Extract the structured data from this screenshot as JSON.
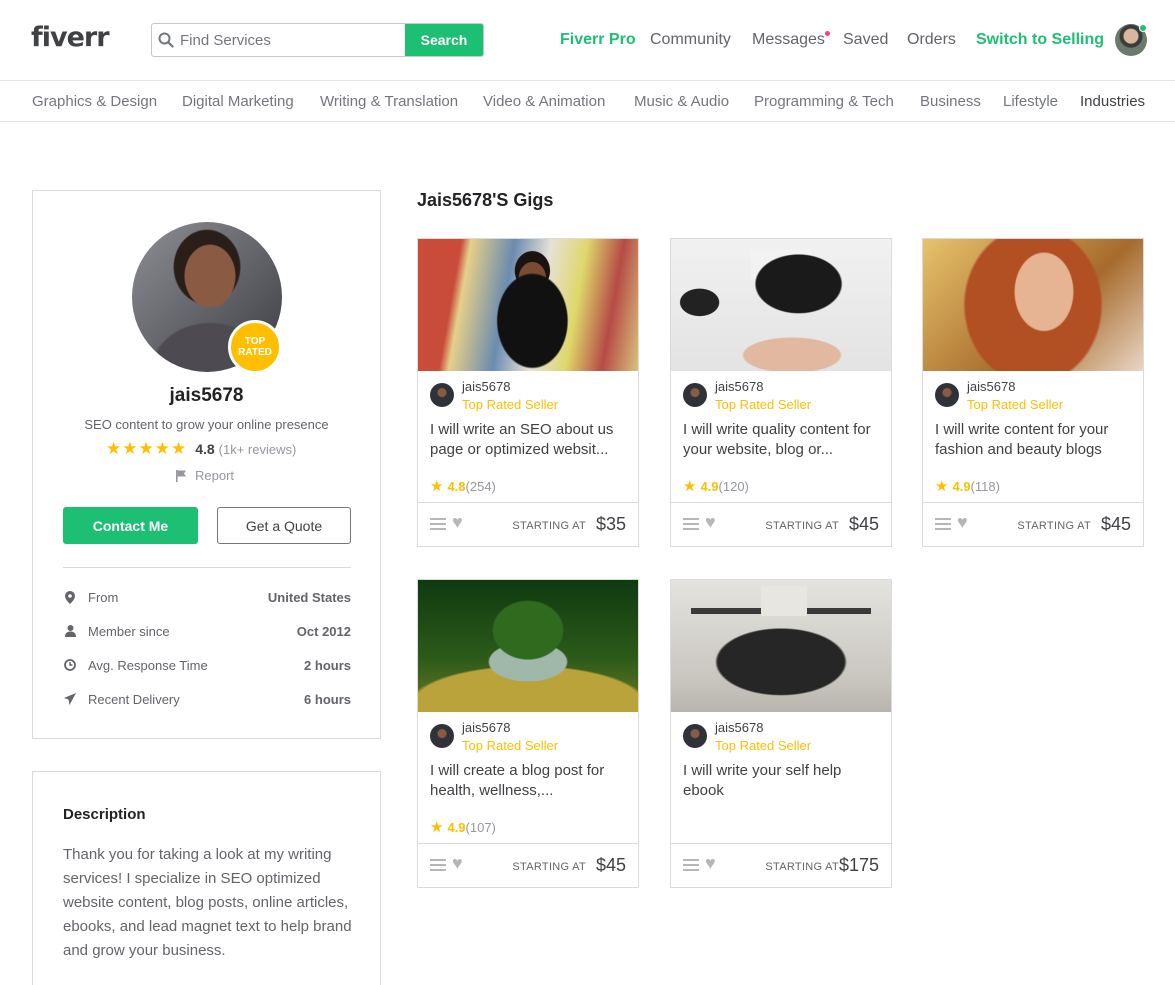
{
  "header": {
    "logo": "fiverr",
    "search_placeholder": "Find Services",
    "search_button": "Search",
    "nav": [
      "Fiverr Pro",
      "Community",
      "Messages",
      "Saved",
      "Orders",
      "Switch to Selling"
    ]
  },
  "categories": [
    "Graphics & Design",
    "Digital Marketing",
    "Writing & Translation",
    "Video & Animation",
    "Music & Audio",
    "Programming & Tech",
    "Business",
    "Lifestyle",
    "Industries"
  ],
  "profile": {
    "badge_line1": "TOP",
    "badge_line2": "RATED",
    "username": "jais5678",
    "tagline": "SEO content to grow your online presence",
    "stars": "★★★★★",
    "rating": "4.8",
    "reviews": "(1k+ reviews)",
    "report": "Report",
    "contact_button": "Contact Me",
    "quote_button": "Get a Quote",
    "stats": [
      {
        "label": "From",
        "value": "United States",
        "icon": "location-pin-icon"
      },
      {
        "label": "Member since",
        "value": "Oct 2012",
        "icon": "user-icon"
      },
      {
        "label": "Avg. Response Time",
        "value": "2 hours",
        "icon": "clock-icon"
      },
      {
        "label": "Recent Delivery",
        "value": "6 hours",
        "icon": "paper-plane-icon"
      }
    ]
  },
  "description": {
    "heading": "Description",
    "text": "Thank you for taking a look at my writing services! I specialize in SEO optimized website content, blog posts, online articles, ebooks, and lead magnet text to help brand and grow your business."
  },
  "gigs_title": "Jais5678'S Gigs",
  "gigs": [
    {
      "seller": "jais5678",
      "level": "Top Rated Seller",
      "title": "I will write an SEO about us page or optimized websit...",
      "rating": "4.8",
      "count": "(254)",
      "starting": "STARTING AT",
      "price": "$35"
    },
    {
      "seller": "jais5678",
      "level": "Top Rated Seller",
      "title": "I will write quality content for your website, blog or...",
      "rating": "4.9",
      "count": "(120)",
      "starting": "STARTING AT",
      "price": "$45"
    },
    {
      "seller": "jais5678",
      "level": "Top Rated Seller",
      "title": "I will write content for your fashion and beauty blogs",
      "rating": "4.9",
      "count": "(118)",
      "starting": "STARTING AT",
      "price": "$45"
    },
    {
      "seller": "jais5678",
      "level": "Top Rated Seller",
      "title": "I will create a blog post for health, wellness,...",
      "rating": "4.9",
      "count": "(107)",
      "starting": "STARTING AT",
      "price": "$45"
    },
    {
      "seller": "jais5678",
      "level": "Top Rated Seller",
      "title": "I will write your self help ebook",
      "rating": "",
      "count": "",
      "starting": "STARTING AT",
      "price": "$175"
    }
  ],
  "colors": {
    "brand_green": "#1dbf73",
    "star_yellow": "#ffbe00",
    "notification_pink": "#ff3c88"
  }
}
